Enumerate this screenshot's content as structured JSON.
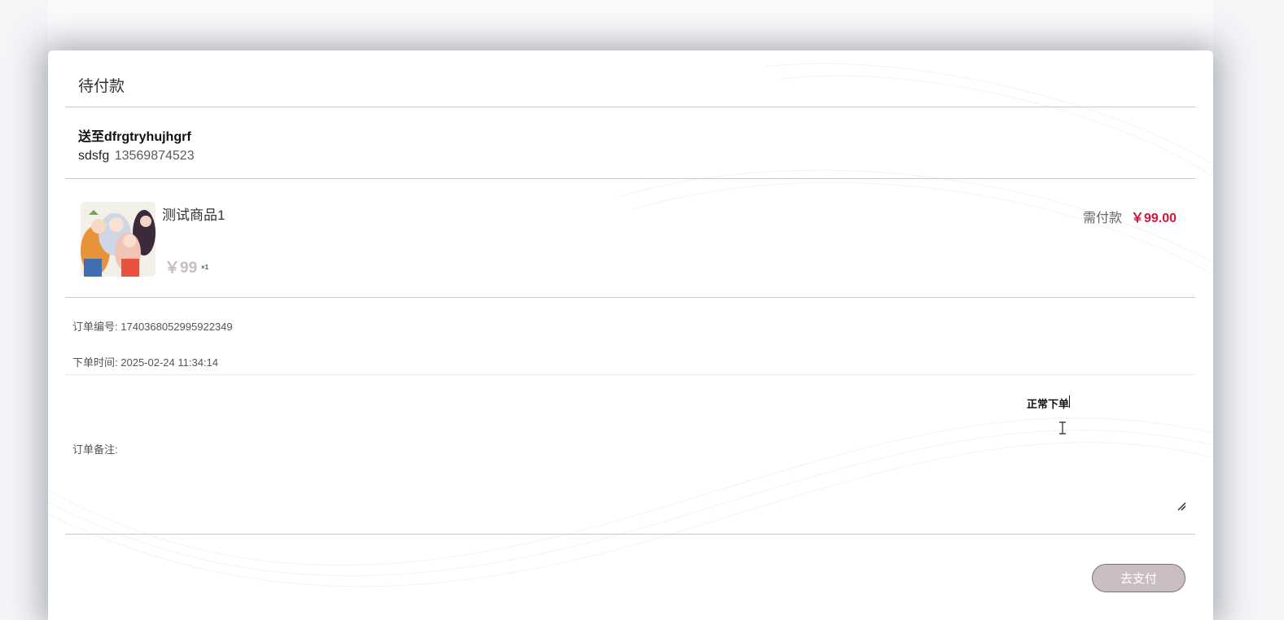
{
  "modal": {
    "title": "待付款"
  },
  "address": {
    "ship_to": "送至dfrgtryhujhgrf",
    "name": "sdsfg",
    "phone": "13569874523"
  },
  "product": {
    "name": "测试商品1",
    "price": "￥99",
    "quantity": "×1",
    "due_label": "需付款",
    "due_amount": "￥99.00"
  },
  "order_info": {
    "number_label": "订单编号:",
    "number": "1740368052995922349",
    "time_label": "下单时间:",
    "time": "2025-02-24 11:34:14"
  },
  "remark": {
    "label": "订单备注:",
    "value": "正常下单"
  },
  "actions": {
    "pay_label": "去支付"
  },
  "icons": {
    "thumbnail": "product-thumbnail",
    "cursor": "text-cursor-icon",
    "resize": "resize-grip-icon"
  },
  "colors": {
    "due_amount": "#d8143a",
    "pay_button": "#cabec4",
    "price_muted": "#c9bcc2"
  }
}
